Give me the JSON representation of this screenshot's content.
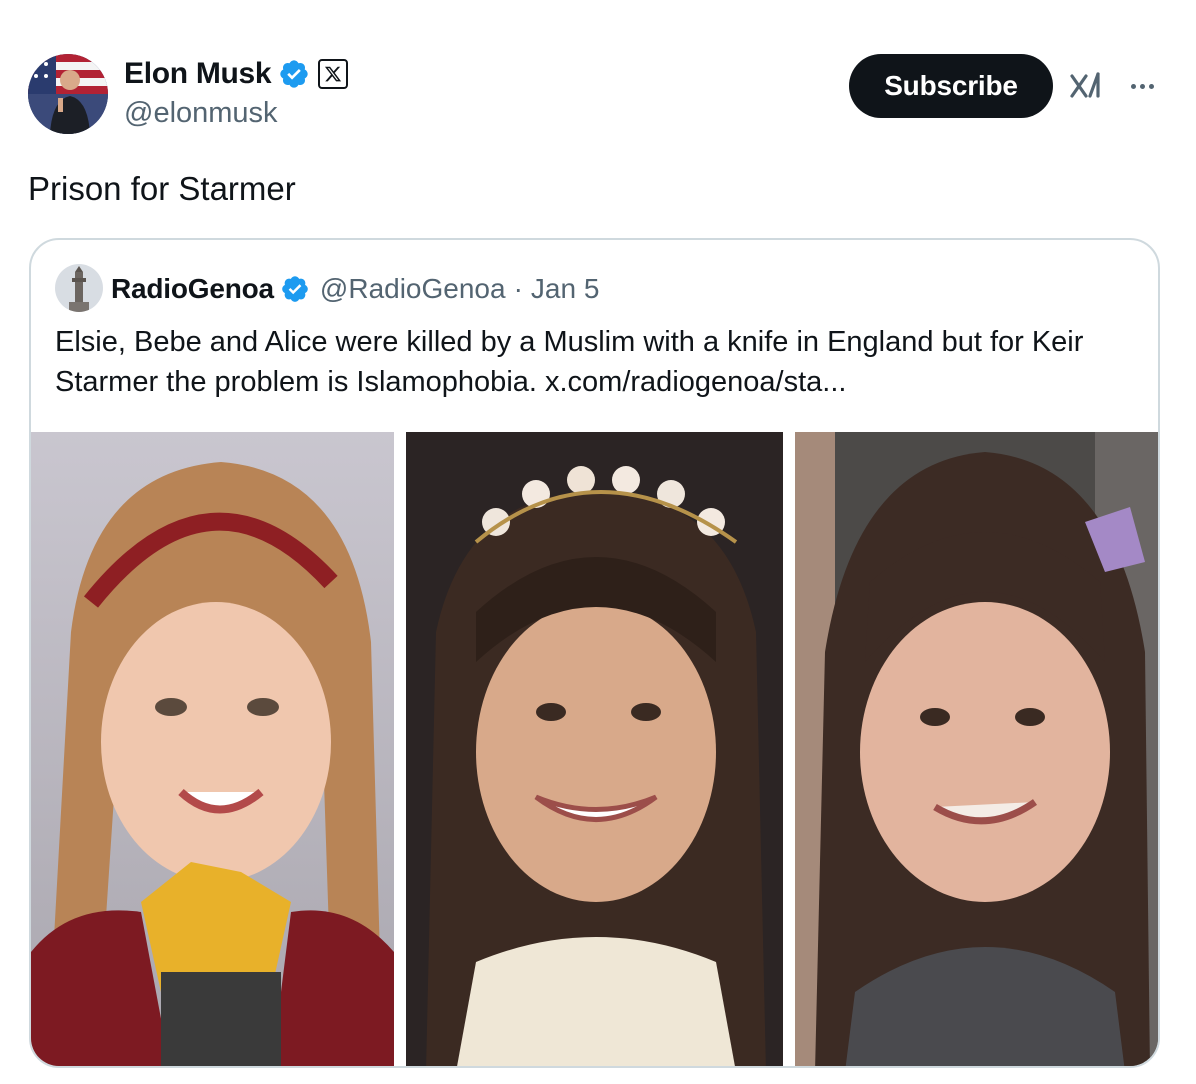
{
  "author": {
    "display_name": "Elon Musk",
    "handle": "@elonmusk",
    "avatar_icon": "profile-photo"
  },
  "actions": {
    "subscribe_label": "Subscribe",
    "grok_icon": "grok-icon",
    "more_icon": "more-options-icon"
  },
  "tweet": {
    "text": "Prison for Starmer"
  },
  "quote": {
    "display_name": "RadioGenoa",
    "handle": "@RadioGenoa",
    "separator": "·",
    "date": "Jan 5",
    "text": "Elsie, Bebe and Alice were killed by a Muslim with a knife in England but for Keir Starmer the problem is Islamophobia.  ",
    "link": "x.com/radiogenoa/sta...",
    "photos": [
      "girl-photo-1",
      "girl-photo-2",
      "girl-photo-3"
    ]
  },
  "colors": {
    "text_primary": "#0f1419",
    "text_secondary": "#536471",
    "verified_blue": "#1d9bf0",
    "border": "#cfd9de"
  }
}
